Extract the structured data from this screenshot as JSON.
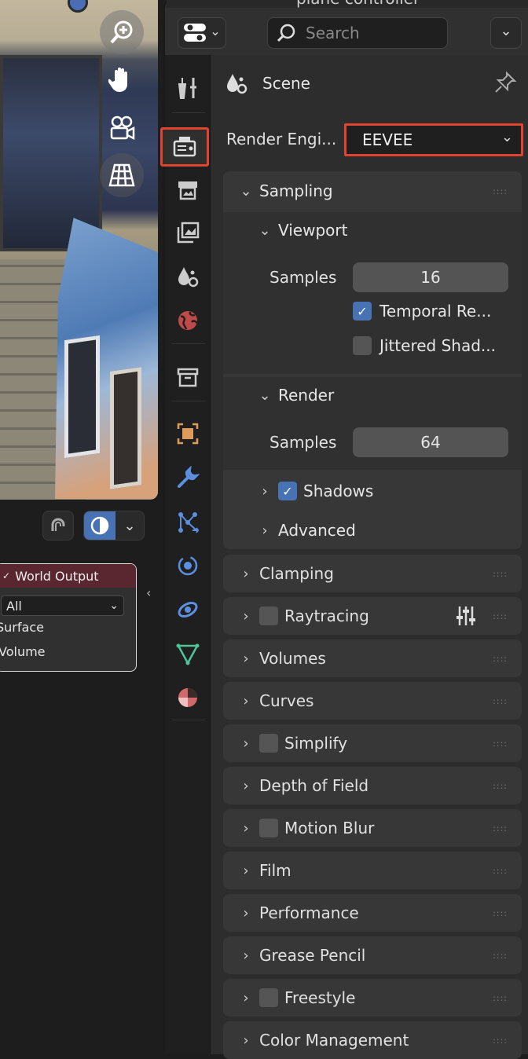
{
  "outliner": {
    "row_text": "plane controller"
  },
  "header": {
    "search_placeholder": "Search"
  },
  "context": {
    "title": "Scene"
  },
  "render_engine": {
    "label": "Render Engi...",
    "value": "EEVEE"
  },
  "sampling": {
    "title": "Sampling",
    "viewport": {
      "title": "Viewport",
      "samples_label": "Samples",
      "samples_value": "16",
      "temporal_label": "Temporal Re...",
      "temporal_checked": true,
      "jittered_label": "Jittered Shad...",
      "jittered_checked": false
    },
    "render": {
      "title": "Render",
      "samples_label": "Samples",
      "samples_value": "64"
    },
    "shadows_label": "Shadows",
    "advanced_label": "Advanced"
  },
  "panels": [
    {
      "label": "Clamping",
      "checkbox": false
    },
    {
      "label": "Raytracing",
      "checkbox": true
    },
    {
      "label": "Volumes",
      "checkbox": false
    },
    {
      "label": "Curves",
      "checkbox": false
    },
    {
      "label": "Simplify",
      "checkbox": true
    },
    {
      "label": "Depth of Field",
      "checkbox": false
    },
    {
      "label": "Motion Blur",
      "checkbox": true
    },
    {
      "label": "Film",
      "checkbox": false
    },
    {
      "label": "Performance",
      "checkbox": false
    },
    {
      "label": "Grease Pencil",
      "checkbox": false
    },
    {
      "label": "Freestyle",
      "checkbox": true
    },
    {
      "label": "Color Management",
      "checkbox": false
    }
  ],
  "node": {
    "title": "World Output",
    "target": "All",
    "sockets": [
      "Surface",
      "Volume"
    ]
  },
  "colors": {
    "accent": "#4772b3",
    "highlight": "#e0442e",
    "world_node_header": "#5a2630"
  },
  "tabs": [
    "tool",
    "render",
    "output",
    "view-layer",
    "scene",
    "world",
    "collection",
    "object",
    "modifiers",
    "particles",
    "physics",
    "constraints",
    "data",
    "material"
  ]
}
